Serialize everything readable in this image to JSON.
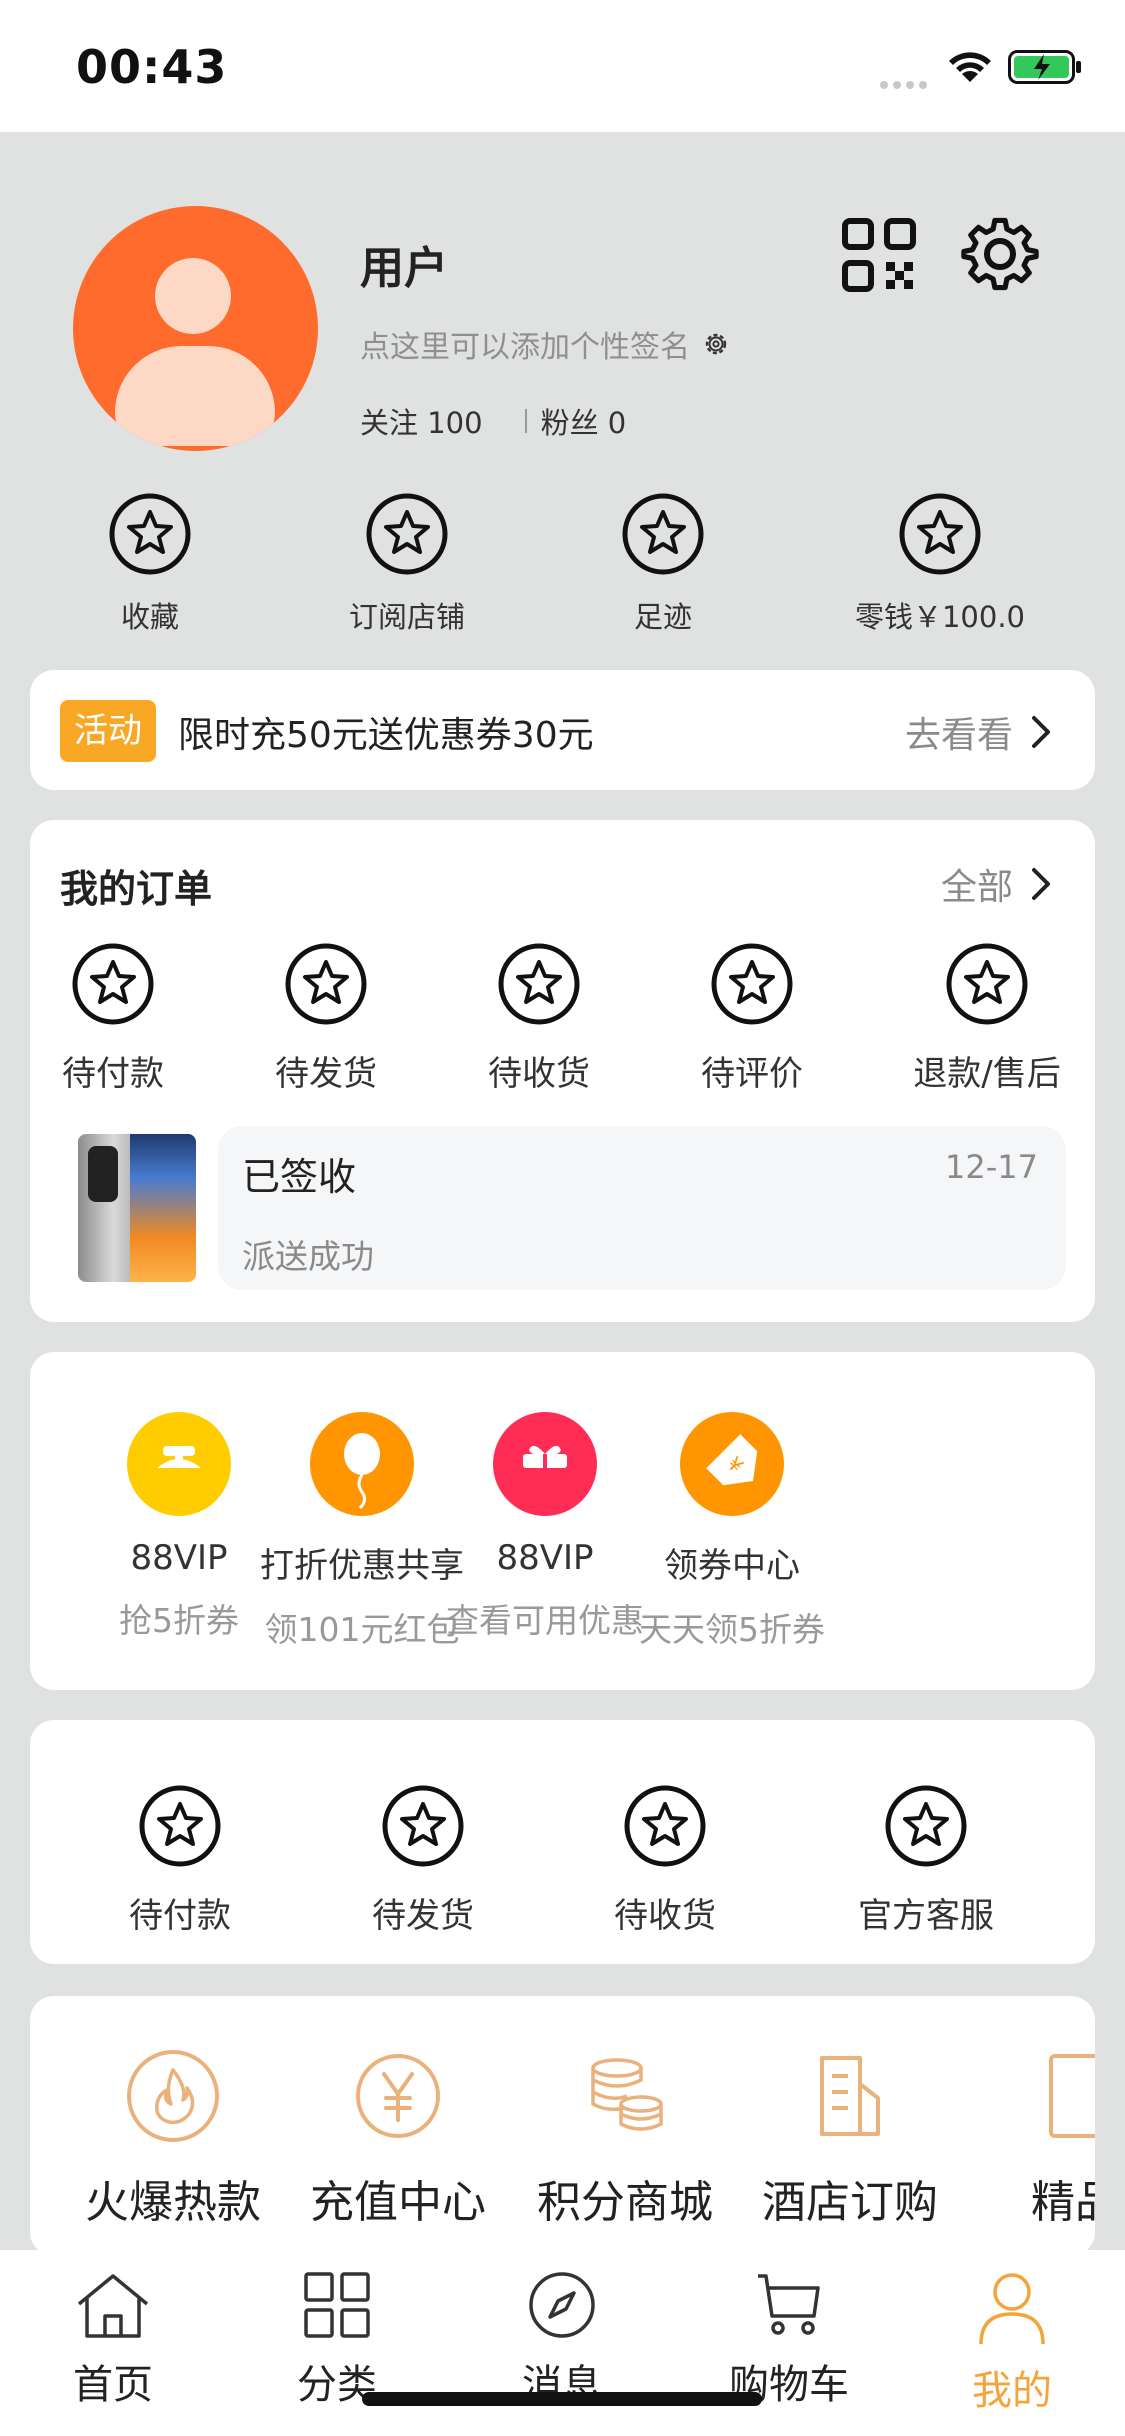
{
  "status_bar": {
    "time": "00:43"
  },
  "profile": {
    "username": "用户",
    "signature_hint": "点这里可以添加个性签名",
    "following": "关注 100",
    "followers": "粉丝 0"
  },
  "quick_links": [
    {
      "label": "收藏"
    },
    {
      "label": "订阅店铺"
    },
    {
      "label": "足迹"
    },
    {
      "label": "零钱￥100.0"
    }
  ],
  "promo_banner": {
    "tag": "活动",
    "text": "限时充50元送优惠券30元",
    "action": "去看看"
  },
  "orders": {
    "title": "我的订单",
    "view_all": "全部",
    "statuses": [
      {
        "label": "待付款"
      },
      {
        "label": "待发货"
      },
      {
        "label": "待收货"
      },
      {
        "label": "待评价"
      },
      {
        "label": "退款/售后"
      }
    ],
    "latest": {
      "status": "已签收",
      "date": "12-17",
      "detail": "派送成功"
    }
  },
  "promotions": [
    {
      "title": "88VIP",
      "subtitle": "抢5折券",
      "color": "#ffcc00",
      "icon": "lamp-icon"
    },
    {
      "title": "打折优惠共享",
      "subtitle": "领101元红包",
      "color": "#ff9500",
      "icon": "balloon-icon"
    },
    {
      "title": "88VIP",
      "subtitle": "查看可用优惠",
      "color": "#ff2d55",
      "icon": "gift-icon"
    },
    {
      "title": "领券中心",
      "subtitle": "天天领5折券",
      "color": "#ff9500",
      "icon": "coupon-icon"
    }
  ],
  "services": [
    {
      "label": "待付款"
    },
    {
      "label": "待发货"
    },
    {
      "label": "待收货"
    },
    {
      "label": "官方客服"
    }
  ],
  "tools": [
    {
      "label": "火爆热款",
      "icon": "fire-icon"
    },
    {
      "label": "充值中心",
      "icon": "yen-icon"
    },
    {
      "label": "积分商城",
      "icon": "coins-icon"
    },
    {
      "label": "酒店订购",
      "icon": "building-icon"
    },
    {
      "label": "精品",
      "icon": "card-icon"
    }
  ],
  "tabbar": [
    {
      "label": "首页",
      "icon": "home-icon"
    },
    {
      "label": "分类",
      "icon": "grid-icon"
    },
    {
      "label": "消息",
      "icon": "compass-icon"
    },
    {
      "label": "购物车",
      "icon": "cart-icon"
    },
    {
      "label": "我的",
      "icon": "person-icon",
      "active": true
    }
  ],
  "colors": {
    "accent": "#f3a43a",
    "avatar": "#ff6b2d",
    "tag": "#f9a825",
    "tool_icon": "#e9b27c"
  }
}
